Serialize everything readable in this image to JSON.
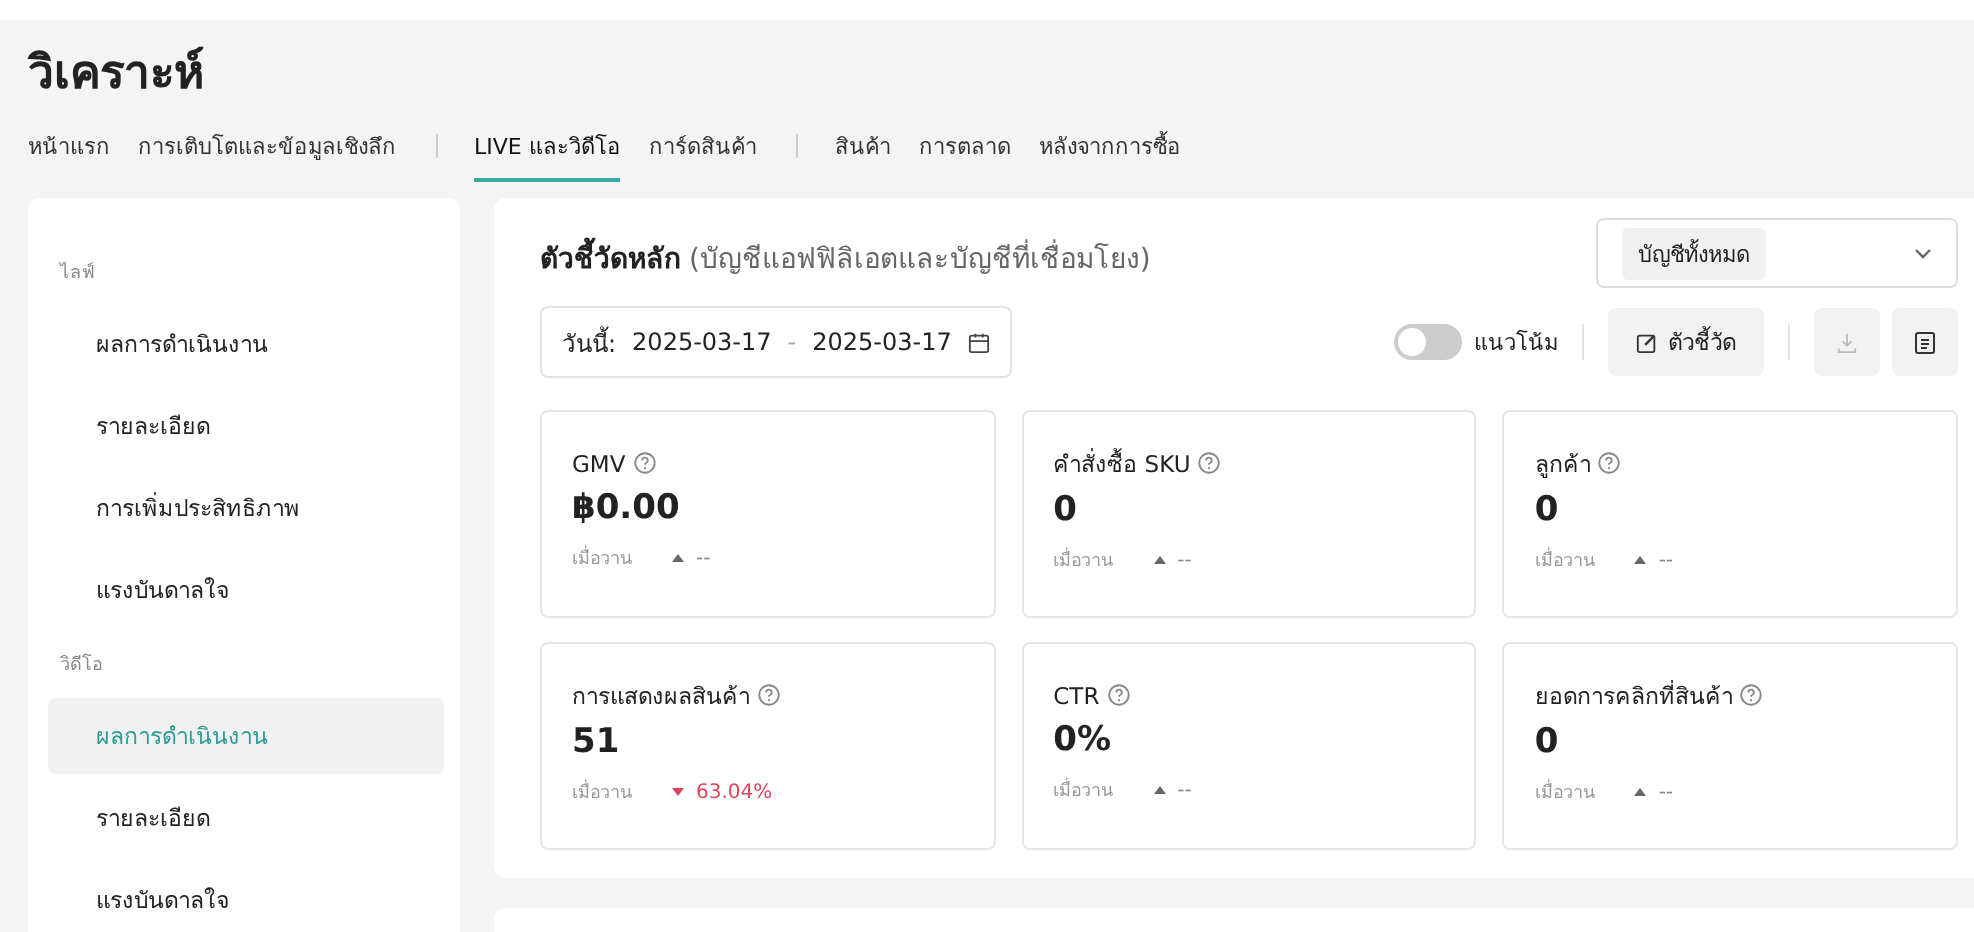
{
  "page_title": "วิเคราะห์",
  "tab_groups": [
    [
      {
        "label": "หน้าแรก",
        "selected": false
      },
      {
        "label": "การเติบโตและข้อมูลเชิงลึก",
        "selected": false
      }
    ],
    [
      {
        "label": "LIVE และวิดีโอ",
        "selected": true
      },
      {
        "label": "การ์ดสินค้า",
        "selected": false
      }
    ],
    [
      {
        "label": "สินค้า",
        "selected": false
      },
      {
        "label": "การตลาด",
        "selected": false
      },
      {
        "label": "หลังจากการซื้อ",
        "selected": false
      }
    ]
  ],
  "sidebar": {
    "sections": [
      {
        "heading": "ไลฟ์",
        "items": [
          {
            "label": "ผลการดำเนินงาน",
            "selected": false
          },
          {
            "label": "รายละเอียด",
            "selected": false
          },
          {
            "label": "การเพิ่มประสิทธิภาพ",
            "selected": false
          },
          {
            "label": "แรงบันดาลใจ",
            "selected": false
          }
        ]
      },
      {
        "heading": "วิดีโอ",
        "items": [
          {
            "label": "ผลการดำเนินงาน",
            "selected": true
          },
          {
            "label": "รายละเอียด",
            "selected": false
          },
          {
            "label": "แรงบันดาลใจ",
            "selected": false
          }
        ]
      }
    ]
  },
  "panel": {
    "title": "ตัวชี้วัดหลัก",
    "subtitle": "(บัญชีแอฟฟิลิเอตและบัญชีที่เชื่อมโยง)",
    "account_select": "บัญชีทั้งหมด",
    "date_label": "วันนี้:",
    "date_from": "2025-03-17",
    "date_separator": "-",
    "date_to": "2025-03-17",
    "trend_toggle": {
      "label": "แนวโน้ม",
      "on": false
    },
    "metrics_button": "ตัวชี้วัด",
    "download_disabled": true
  },
  "metrics": [
    {
      "label": "GMV",
      "value": "฿0.00",
      "compare": "เมื่อวาน",
      "kind": "up",
      "change": "--"
    },
    {
      "label": "คำสั่งซื้อ SKU",
      "value": "0",
      "compare": "เมื่อวาน",
      "kind": "up",
      "change": "--"
    },
    {
      "label": "ลูกค้า",
      "value": "0",
      "compare": "เมื่อวาน",
      "kind": "up",
      "change": "--"
    },
    {
      "label": "การแสดงผลสินค้า",
      "value": "51",
      "compare": "เมื่อวาน",
      "kind": "down",
      "change": "63.04%"
    },
    {
      "label": "CTR",
      "value": "0%",
      "compare": "เมื่อวาน",
      "kind": "up",
      "change": "--"
    },
    {
      "label": "ยอดการคลิกที่สินค้า",
      "value": "0",
      "compare": "เมื่อวาน",
      "kind": "up",
      "change": "--"
    }
  ]
}
